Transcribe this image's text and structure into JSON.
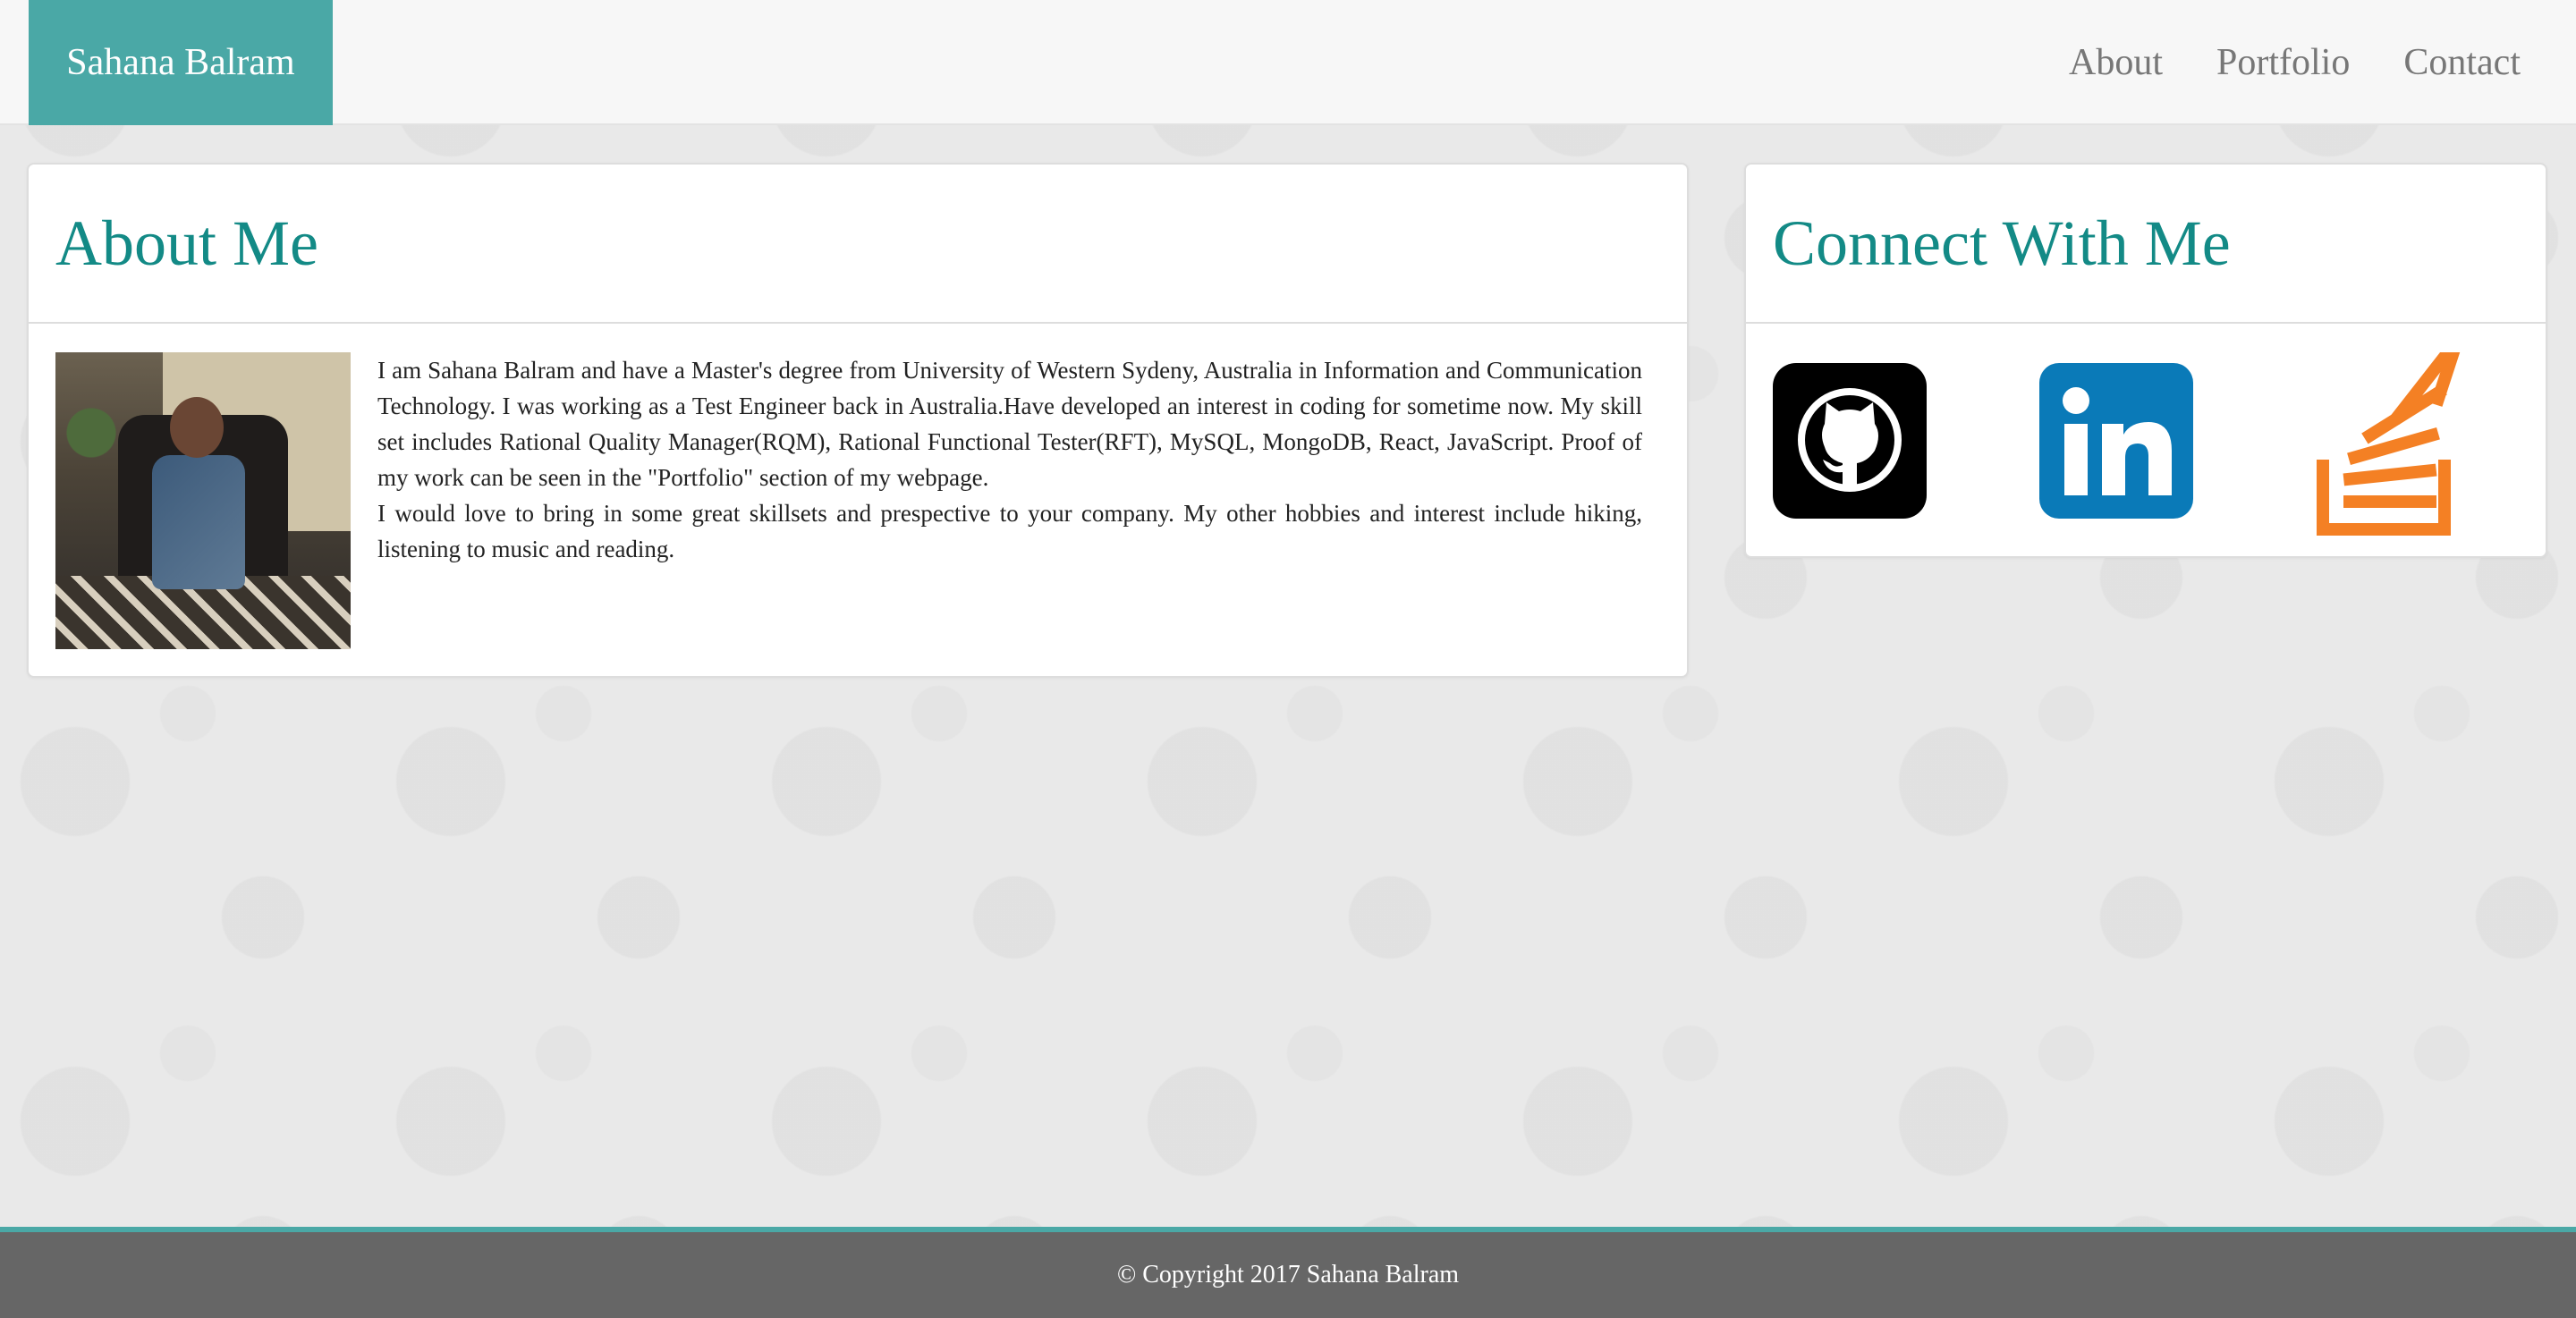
{
  "nav": {
    "brand": "Sahana Balram",
    "links": [
      "About",
      "Portfolio",
      "Contact"
    ]
  },
  "about": {
    "title": "About Me",
    "paragraph1": "I am Sahana Balram and have a Master's degree from University of Western Sydeny, Australia in Information and Communication Technology. I was working as a Test Engineer back in Australia.Have developed an interest in coding for sometime now. My skill set includes Rational Quality Manager(RQM), Rational Functional Tester(RFT), MySQL, MongoDB, React, JavaScript. Proof of my work can be seen in the \"Portfolio\" section of my webpage.",
    "paragraph2": "I would love to bring in some great skillsets and prespective to your company. My other hobbies and interest include hiking, listening to music and reading."
  },
  "connect": {
    "title": "Connect With Me",
    "icons": [
      "github-icon",
      "linkedin-icon",
      "stackoverflow-icon"
    ],
    "colors": {
      "github": "#000000",
      "linkedin": "#0a7ab8",
      "stackoverflow": "#f48024"
    }
  },
  "footer": {
    "text": "© Copyright 2017 Sahana Balram"
  },
  "theme": {
    "accent": "#4aa8a6",
    "heading": "#138a86",
    "footer_bg": "#666666"
  }
}
